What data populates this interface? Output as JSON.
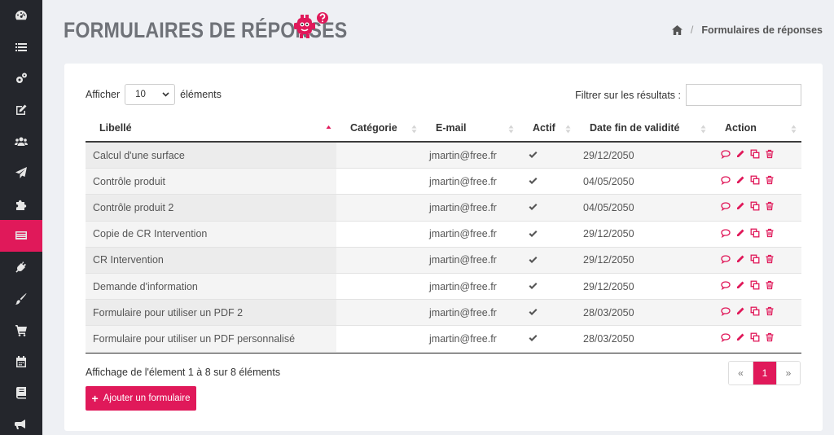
{
  "header": {
    "title": "FORMULAIRES DE RÉPONSES",
    "breadcrumb_current": "Formulaires de réponses",
    "breadcrumb_sep": "/"
  },
  "controls": {
    "show_label": "Afficher",
    "page_length": "10",
    "elements_label": "éléments",
    "filter_label": "Filtrer sur les résultats :"
  },
  "table": {
    "columns": [
      "Libellé",
      "Catégorie",
      "E-mail",
      "Actif",
      "Date fin de validité",
      "Action"
    ],
    "rows": [
      {
        "label": "Calcul d'une surface",
        "category": "",
        "email": "jmartin@free.fr",
        "date": "29/12/2050"
      },
      {
        "label": "Contrôle produit",
        "category": "",
        "email": "jmartin@free.fr",
        "date": "04/05/2050"
      },
      {
        "label": "Contrôle produit 2",
        "category": "",
        "email": "jmartin@free.fr",
        "date": "04/05/2050"
      },
      {
        "label": "Copie de CR Intervention",
        "category": "",
        "email": "jmartin@free.fr",
        "date": "29/12/2050"
      },
      {
        "label": "CR Intervention",
        "category": "",
        "email": "jmartin@free.fr",
        "date": "29/12/2050"
      },
      {
        "label": "Demande d'information",
        "category": "",
        "email": "jmartin@free.fr",
        "date": "29/12/2050"
      },
      {
        "label": "Formulaire pour utiliser un PDF 2",
        "category": "",
        "email": "jmartin@free.fr",
        "date": "28/03/2050"
      },
      {
        "label": "Formulaire pour utiliser un PDF personnalisé",
        "category": "",
        "email": "jmartin@free.fr",
        "date": "28/03/2050"
      }
    ]
  },
  "footer": {
    "info": "Affichage de l'élement 1 à 8 sur 8 éléments",
    "pager_prev": "«",
    "pager_current": "1",
    "pager_next": "»",
    "add_button": "Ajouter un formulaire"
  },
  "sidebar": {
    "active_index": 7,
    "items": [
      "dashboard-icon",
      "list-icon",
      "cogs-icon",
      "edit-icon",
      "users-icon",
      "send-icon",
      "puzzle-icon",
      "forms-icon",
      "plug-icon",
      "brush-icon",
      "cart-icon",
      "calendar-icon",
      "book-icon",
      "bullhorn-icon"
    ]
  },
  "colors": {
    "accent": "#e0195a",
    "sidebar": "#24262c",
    "background": "#eef0f4"
  }
}
